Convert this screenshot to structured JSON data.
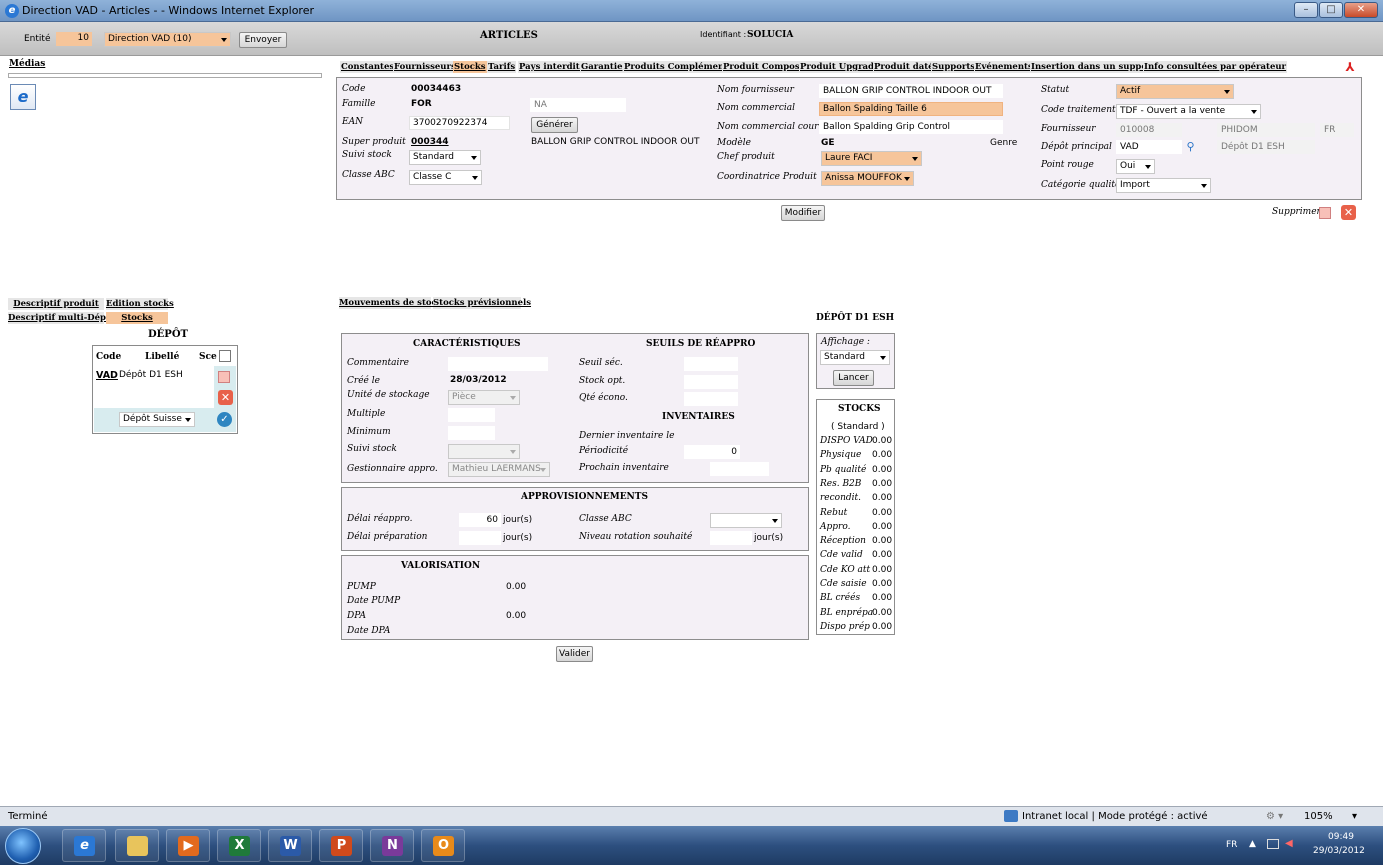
{
  "window": {
    "title": "Direction VAD - Articles - - Windows Internet Explorer"
  },
  "header": {
    "entite_label": "Entité",
    "entite_value": "10",
    "entite_select": "Direction VAD (10)",
    "envoyer": "Envoyer",
    "page_title": "ARTICLES",
    "identifiant_label": "Identifiant :",
    "identifiant_value": "SOLUCIA"
  },
  "medias": {
    "label": "Médias"
  },
  "tabs": [
    "Constantes",
    "Fournisseurs",
    "Stocks",
    "Tarifs",
    "Pays interdits",
    "Garantie",
    "Produits Compléments",
    "Produit Composé",
    "Produit Upgrade",
    "Produit daté",
    "Supports",
    "Evénements",
    "Insertion dans un support",
    "Info consultées par opérateur"
  ],
  "article": {
    "code_label": "Code",
    "code": "00034463",
    "famille_label": "Famille",
    "famille": "FOR",
    "famille_na": "NA",
    "ean_label": "EAN",
    "ean": "3700270922374",
    "generer": "Générer",
    "super_label": "Super produit",
    "super": "000344",
    "super_desc": "BALLON GRIP CONTROL INDOOR OUT",
    "suivi_label": "Suivi stock",
    "suivi": "Standard",
    "abc_label": "Classe ABC",
    "abc": "Classe C",
    "nomfourn_label": "Nom fournisseur",
    "nomfourn": "BALLON GRIP CONTROL INDOOR OUT",
    "nomcom_label": "Nom commercial",
    "nomcom": "Ballon Spalding Taille 6",
    "nomcourt_label": "Nom commercial court",
    "nomcourt": "Ballon Spalding Grip Control",
    "modele_label": "Modèle",
    "modele": "GE",
    "genre_label": "Genre",
    "chef_label": "Chef produit",
    "chef": "Laure FACI",
    "coord_label": "Coordinatrice Produit",
    "coord": "Anissa MOUFFOK",
    "statut_label": "Statut",
    "statut": "Actif",
    "codetrait_label": "Code traitement",
    "codetrait": "TDF - Ouvert a la vente",
    "fourn_label": "Fournisseur",
    "fourn_code": "010008",
    "fourn_name": "PHIDOM",
    "fourn_country": "FR",
    "depot_label": "Dépôt principal",
    "depot": "VAD",
    "depot_name": "Dépôt D1 ESH",
    "point_label": "Point rouge",
    "point": "Oui",
    "catq_label": "Catégorie qualité",
    "catq": "Import",
    "modifier": "Modifier",
    "supprimer": "Supprimer"
  },
  "left": {
    "tabs": [
      "Descriptif produit",
      "Edition stocks",
      "Descriptif multi-Dépôt",
      "Stocks"
    ],
    "depot_title": "DÉPÔT",
    "cols": [
      "Code",
      "Libellé",
      "Sce"
    ],
    "row": {
      "code": "VAD",
      "libelle": "Dépôt D1 ESH"
    },
    "select": "Dépôt Suisse"
  },
  "stock_tabs": [
    "Mouvements de stock",
    "Stocks prévisionnels"
  ],
  "carac": {
    "title": "CARACTÉRISTIQUES",
    "commentaire": "Commentaire",
    "cree_label": "Créé le",
    "cree": "28/03/2012",
    "unite_label": "Unité de stockage",
    "unite": "Pièce",
    "multiple": "Multiple",
    "minimum": "Minimum",
    "suivi_label": "Suivi stock",
    "gest_label": "Gestionnaire appro.",
    "gest": "Mathieu LAERMANS"
  },
  "seuils": {
    "title": "SEUILS DE RÉAPPRO",
    "seuil": "Seuil séc.",
    "stockopt": "Stock opt.",
    "qte": "Qté écono.",
    "inv_title": "INVENTAIRES",
    "dernier": "Dernier inventaire le",
    "periodicite": "Périodicité",
    "periodicite_val": "0",
    "prochain": "Prochain inventaire"
  },
  "appro": {
    "title": "APPROVISIONNEMENTS",
    "delai_label": "Délai réappro.",
    "delai": "60",
    "jours": "jour(s)",
    "prep_label": "Délai préparation",
    "abc_label": "Classe ABC",
    "rotation_label": "Niveau rotation souhaité"
  },
  "valo": {
    "title": "VALORISATION",
    "pump": "PUMP",
    "pump_val": "0.00",
    "datepump": "Date PUMP",
    "dpa": "DPA",
    "dpa_val": "0.00",
    "datedpa": "Date DPA"
  },
  "valider": "Valider",
  "depot_panel": {
    "title": "DÉPÔT D1 ESH",
    "affichage": "Affichage :",
    "aff_value": "Standard",
    "lancer": "Lancer"
  },
  "stocks": {
    "title": "STOCKS",
    "sub": "( Standard )",
    "rows": [
      {
        "l": "DISPO VAD",
        "v": "0.00"
      },
      {
        "l": "Physique",
        "v": "0.00"
      },
      {
        "l": "Pb qualité",
        "v": "0.00"
      },
      {
        "l": "Res. B2B",
        "v": "0.00"
      },
      {
        "l": "recondit.",
        "v": "0.00"
      },
      {
        "l": "Rebut",
        "v": "0.00"
      },
      {
        "l": "Appro.",
        "v": "0.00"
      },
      {
        "l": "Réception",
        "v": "0.00"
      },
      {
        "l": "Cde valid",
        "v": "0.00"
      },
      {
        "l": "Cde KO att",
        "v": "0.00"
      },
      {
        "l": "Cde saisie",
        "v": "0.00"
      },
      {
        "l": "BL créés",
        "v": "0.00"
      },
      {
        "l": "BL enprépa",
        "v": "0.00"
      },
      {
        "l": "Dispo prép",
        "v": "0.00"
      }
    ]
  },
  "status": {
    "left": "Terminé",
    "zone": "Intranet local | Mode protégé : activé",
    "zoom": "105%"
  },
  "taskbar": {
    "lang": "FR",
    "time": "09:49",
    "date": "29/03/2012"
  }
}
